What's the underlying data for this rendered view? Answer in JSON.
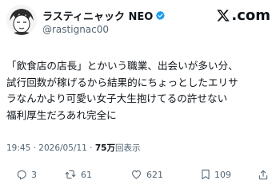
{
  "user": {
    "display_name": "ラスティニャック NEO",
    "handle": "@rastignac00",
    "verified_icon": "verified-badge-icon",
    "badge_color": "#1d9bf0"
  },
  "brand": {
    "label": ".com",
    "logo_icon": "x-logo-icon"
  },
  "tweet": {
    "lines": [
      "「飲食店の店長」とかいう職業、出会いが多い分、",
      "試行回数が稼げるから結果的にちょっとしたエリサ",
      "ラなんかより可愛い女子大生抱けてるの許せない",
      "福利厚生だろあれ完全に"
    ]
  },
  "meta": {
    "time": "19:45",
    "sep": " · ",
    "date": "2026/05/11",
    "views": "75万",
    "views_suffix": "回表示"
  },
  "actions": {
    "reply": {
      "icon": "reply-icon",
      "count": "3"
    },
    "retweet": {
      "icon": "retweet-icon",
      "count": "61"
    },
    "like": {
      "icon": "heart-icon",
      "count": "621"
    },
    "bookmark": {
      "icon": "bookmark-icon",
      "count": "109"
    },
    "share": {
      "icon": "share-icon"
    }
  },
  "colors": {
    "text": "#0f1419",
    "secondary": "#536471"
  }
}
